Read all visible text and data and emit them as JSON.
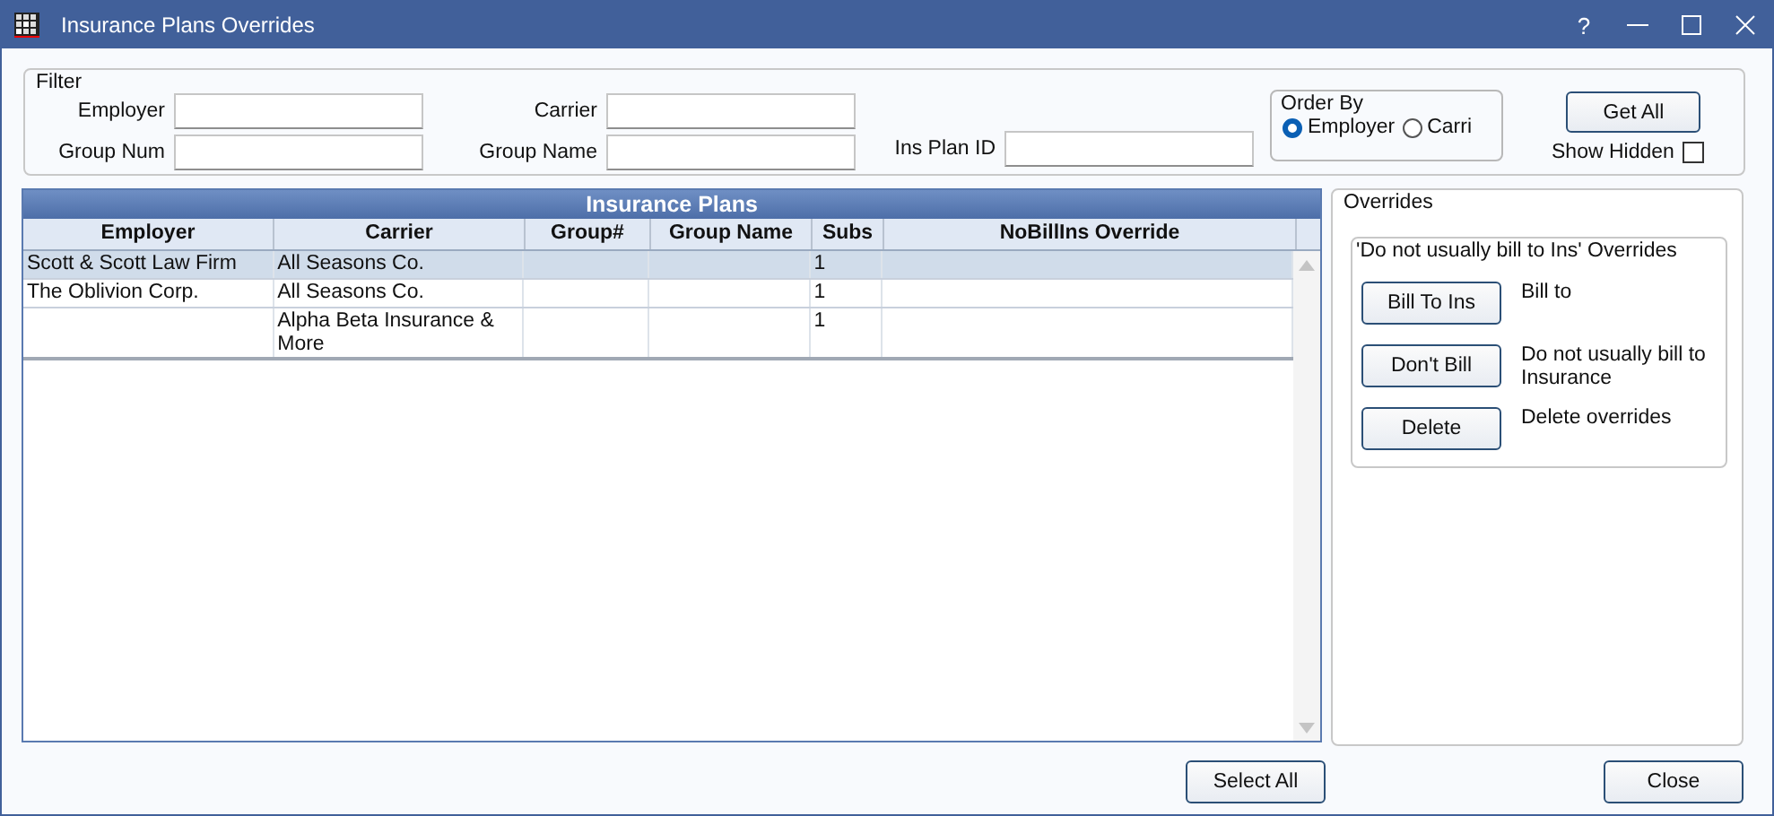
{
  "window": {
    "title": "Insurance Plans Overrides",
    "controls": [
      "?"
    ]
  },
  "filter": {
    "title": "Filter",
    "fields": [
      {
        "label": "Employer"
      },
      {
        "label": "Carrier"
      },
      {
        "label": "Group Num"
      },
      {
        "label": "Group Name"
      },
      {
        "label": "Ins Plan ID"
      }
    ],
    "order_by": {
      "title": "Order By",
      "options": [
        {
          "label": "Employer",
          "selected": true
        },
        {
          "label": "Carri",
          "selected": false
        }
      ]
    },
    "get_all": "Get All",
    "show_hidden": {
      "label": "Show Hidden",
      "checked": false
    }
  },
  "table": {
    "title": "Insurance Plans",
    "columns": [
      "Employer",
      "Carrier",
      "Group#",
      "Group Name",
      "Subs",
      "NoBillIns Override"
    ],
    "rows": [
      {
        "cells": [
          "Scott & Scott Law Firm",
          "All Seasons Co.",
          "",
          "",
          "1",
          ""
        ],
        "selected": true
      },
      {
        "cells": [
          "The Oblivion Corp.",
          "All Seasons Co.",
          "",
          "",
          "1",
          ""
        ],
        "selected": false
      },
      {
        "cells": [
          "",
          "Alpha Beta Insurance & More",
          "",
          "",
          "1",
          ""
        ],
        "selected": false
      }
    ]
  },
  "overrides": {
    "title": "Overrides",
    "group_title": "'Do not usually bill to Ins' Overrides",
    "actions": [
      {
        "button": "Bill To Ins",
        "description": "Bill to"
      },
      {
        "button": "Don't Bill",
        "description": "Do not usually bill to Insurance"
      },
      {
        "button": "Delete",
        "description": "Delete overrides"
      }
    ]
  },
  "buttons": {
    "select_all": "Select All",
    "close": "Close"
  }
}
